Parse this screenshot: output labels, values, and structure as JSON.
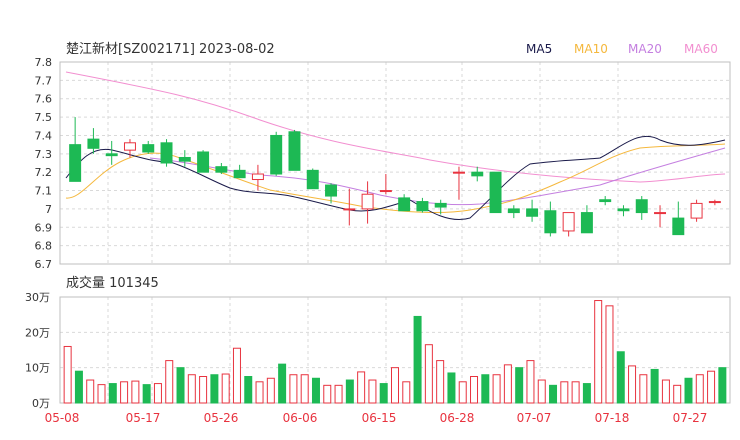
{
  "header": {
    "title": "楚江新材[SZ002171] 2023-08-02",
    "legend": [
      {
        "label": "MA5",
        "color": "#1a1a4a"
      },
      {
        "label": "MA10",
        "color": "#f5b83d"
      },
      {
        "label": "MA20",
        "color": "#c47fe0"
      },
      {
        "label": "MA60",
        "color": "#f28fd0"
      }
    ]
  },
  "volume_title": "成交量 101345",
  "chart_data": [
    {
      "type": "candlestick",
      "title": "楚江新材[SZ002171] 2023-08-02",
      "ylim": [
        6.7,
        7.8
      ],
      "yticks": [
        "7.8",
        "7.7",
        "7.6",
        "7.5",
        "7.4",
        "7.3",
        "7.2",
        "7.1",
        "7",
        "6.9",
        "6.8",
        "6.7"
      ],
      "xtick_labels": [
        "05-08",
        "05-17",
        "05-26",
        "06-06",
        "06-15",
        "06-28",
        "07-07",
        "07-18",
        "07-27"
      ],
      "xtick_index": [
        0,
        6,
        12,
        18,
        24,
        30,
        36,
        42,
        48
      ],
      "up_color": "#e8333f",
      "down_color": "#1db954",
      "ohlc": [
        [
          7.35,
          7.5,
          7.15,
          7.15
        ],
        [
          7.38,
          7.44,
          7.3,
          7.33
        ],
        [
          7.3,
          7.37,
          7.24,
          7.29
        ],
        [
          7.32,
          7.38,
          7.28,
          7.36
        ],
        [
          7.35,
          7.37,
          7.3,
          7.31
        ],
        [
          7.36,
          7.38,
          7.23,
          7.25
        ],
        [
          7.28,
          7.32,
          7.23,
          7.26
        ],
        [
          7.31,
          7.32,
          7.2,
          7.2
        ],
        [
          7.23,
          7.25,
          7.19,
          7.2
        ],
        [
          7.21,
          7.24,
          7.18,
          7.17
        ],
        [
          7.16,
          7.24,
          7.1,
          7.19
        ],
        [
          7.4,
          7.42,
          7.18,
          7.19
        ],
        [
          7.42,
          7.43,
          7.21,
          7.21
        ],
        [
          7.21,
          7.22,
          7.11,
          7.11
        ],
        [
          7.13,
          7.14,
          7.03,
          7.07
        ],
        [
          7.0,
          7.11,
          6.91,
          7.0
        ],
        [
          7.0,
          7.15,
          6.92,
          7.08
        ],
        [
          7.1,
          7.19,
          7.08,
          7.1
        ],
        [
          7.06,
          7.08,
          6.99,
          6.99
        ],
        [
          7.04,
          7.06,
          6.98,
          6.99
        ],
        [
          7.03,
          7.05,
          6.97,
          7.01
        ],
        [
          7.2,
          7.23,
          7.05,
          7.2
        ],
        [
          7.2,
          7.23,
          7.15,
          7.18
        ],
        [
          7.2,
          7.2,
          6.98,
          6.98
        ],
        [
          7.0,
          7.02,
          6.95,
          6.98
        ],
        [
          7.0,
          7.05,
          6.93,
          6.96
        ],
        [
          6.99,
          7.04,
          6.85,
          6.87
        ],
        [
          6.88,
          6.98,
          6.85,
          6.98
        ],
        [
          6.98,
          7.02,
          6.87,
          6.87
        ],
        [
          7.05,
          7.07,
          7.02,
          7.04
        ],
        [
          7.0,
          7.02,
          6.96,
          6.99
        ],
        [
          7.05,
          7.07,
          6.94,
          6.98
        ],
        [
          6.98,
          7.02,
          6.9,
          6.98
        ],
        [
          6.95,
          7.04,
          6.86,
          6.86
        ],
        [
          6.95,
          7.05,
          6.93,
          7.03
        ],
        [
          7.04,
          7.05,
          7.02,
          7.04
        ]
      ],
      "volumes_wan": [
        16.0,
        9.0,
        6.5,
        5.2,
        5.5,
        6.0,
        6.2,
        5.2,
        5.5,
        12.0,
        10.0,
        8.0,
        7.5,
        8.0,
        8.2,
        15.5,
        7.5,
        6.0,
        7.0,
        11.0,
        8.0,
        8.0,
        7.0,
        5.0,
        5.0,
        6.5,
        8.8,
        6.5,
        5.5,
        10.0,
        6.0,
        24.5,
        16.5,
        12.0,
        8.5,
        6.0,
        7.5,
        8.0,
        8.0,
        10.8,
        10.0,
        12.0,
        6.5,
        5.0,
        6.0,
        6.0,
        5.5,
        29.0,
        27.5,
        14.5,
        10.5,
        8.0,
        9.5,
        6.5,
        5.0,
        7.0,
        8.0,
        9.0,
        10.0
      ],
      "vol_ylim": [
        0,
        30
      ],
      "vol_yticks": [
        "30万",
        "20万",
        "10万",
        "0万"
      ]
    }
  ]
}
